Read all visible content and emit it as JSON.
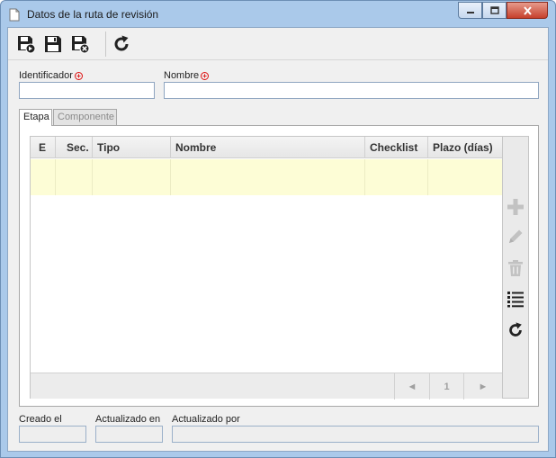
{
  "window": {
    "title": "Datos de la ruta de revisión",
    "icons": {
      "document": "document-icon",
      "minimize": "minimize-icon",
      "maximize": "maximize-icon",
      "close": "close-icon"
    }
  },
  "toolbar": {
    "buttons": [
      {
        "name": "save-new-button",
        "icon": "save-new-icon"
      },
      {
        "name": "save-button",
        "icon": "save-icon"
      },
      {
        "name": "save-close-button",
        "icon": "save-close-icon"
      },
      {
        "name": "refresh-button",
        "icon": "refresh-icon"
      }
    ]
  },
  "form": {
    "identificador": {
      "label": "Identificador",
      "value": "",
      "required": true
    },
    "nombre": {
      "label": "Nombre",
      "value": "",
      "required": true
    }
  },
  "tabs": [
    {
      "label": "Etapa",
      "active": true
    },
    {
      "label": "Componente",
      "active": false
    }
  ],
  "grid": {
    "columns": [
      "E",
      "Sec.",
      "Tipo",
      "Nombre",
      "Checklist",
      "Plazo (días)"
    ],
    "rows": [
      [
        "",
        "",
        "",
        "",
        "",
        ""
      ]
    ],
    "pager": {
      "prev": "◄",
      "page": "1",
      "next": "►"
    }
  },
  "side_actions": [
    {
      "name": "add-button",
      "icon": "plus-icon",
      "enabled": false
    },
    {
      "name": "edit-button",
      "icon": "pencil-icon",
      "enabled": false
    },
    {
      "name": "delete-button",
      "icon": "trash-icon",
      "enabled": false
    },
    {
      "name": "list-button",
      "icon": "list-icon",
      "enabled": true
    },
    {
      "name": "grid-refresh-button",
      "icon": "refresh-icon",
      "enabled": true
    }
  ],
  "footer": {
    "created": {
      "label": "Creado el",
      "value": ""
    },
    "updated_on": {
      "label": "Actualizado en",
      "value": ""
    },
    "updated_by": {
      "label": "Actualizado por",
      "value": ""
    }
  },
  "colors": {
    "titlebar": "#aac9ea",
    "row_selected": "#fdfdd6",
    "close_button": "#c6402c",
    "required": "#dd1111"
  }
}
